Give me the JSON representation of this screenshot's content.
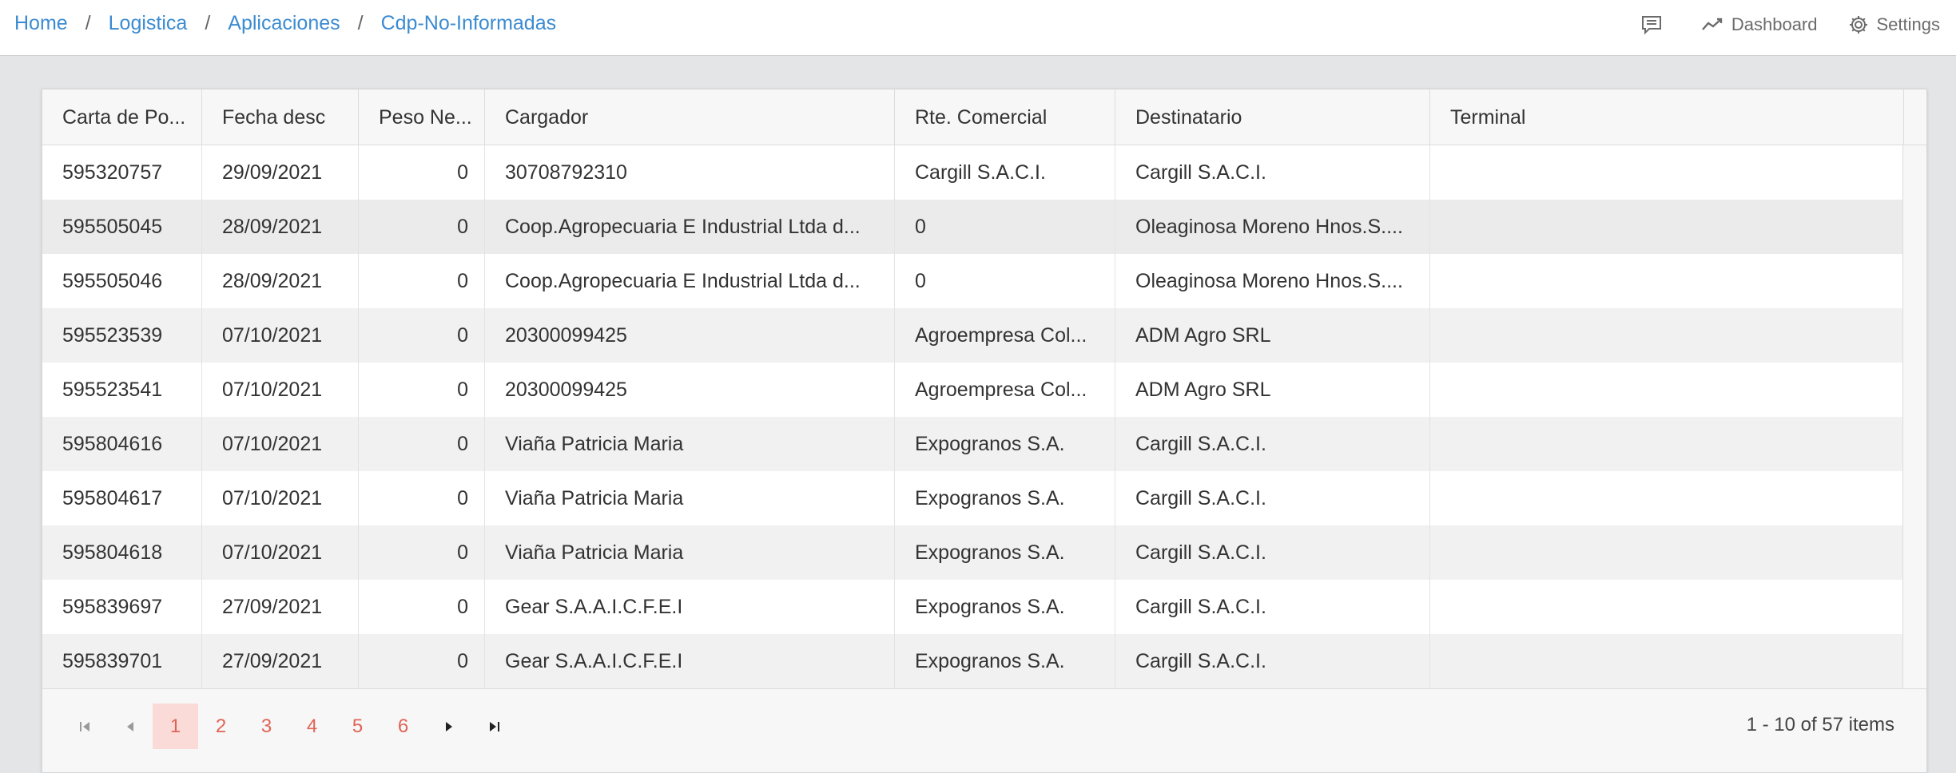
{
  "breadcrumb": [
    "Home",
    "Logistica",
    "Aplicaciones",
    "Cdp-No-Informadas"
  ],
  "topnav": {
    "chat_icon": "chat-icon",
    "dashboard_label": "Dashboard",
    "settings_label": "Settings"
  },
  "columns": [
    "Carta de Po...",
    "Fecha desc",
    "Peso Ne...",
    "Cargador",
    "Rte. Comercial",
    "Destinatario",
    "Terminal"
  ],
  "rows": [
    [
      "595320757",
      "29/09/2021",
      "0",
      "30708792310",
      "Cargill S.A.C.I.",
      "Cargill S.A.C.I.",
      ""
    ],
    [
      "595505045",
      "28/09/2021",
      "0",
      "Coop.Agropecuaria E Industrial Ltda d...",
      "0",
      "Oleaginosa Moreno Hnos.S....",
      ""
    ],
    [
      "595505046",
      "28/09/2021",
      "0",
      "Coop.Agropecuaria E Industrial Ltda d...",
      "0",
      "Oleaginosa Moreno Hnos.S....",
      ""
    ],
    [
      "595523539",
      "07/10/2021",
      "0",
      "20300099425",
      "Agroempresa Col...",
      "ADM Agro SRL",
      ""
    ],
    [
      "595523541",
      "07/10/2021",
      "0",
      "20300099425",
      "Agroempresa Col...",
      "ADM Agro SRL",
      ""
    ],
    [
      "595804616",
      "07/10/2021",
      "0",
      "Viaña Patricia Maria",
      "Expogranos S.A.",
      "Cargill S.A.C.I.",
      ""
    ],
    [
      "595804617",
      "07/10/2021",
      "0",
      "Viaña Patricia Maria",
      "Expogranos S.A.",
      "Cargill S.A.C.I.",
      ""
    ],
    [
      "595804618",
      "07/10/2021",
      "0",
      "Viaña Patricia Maria",
      "Expogranos S.A.",
      "Cargill S.A.C.I.",
      ""
    ],
    [
      "595839697",
      "27/09/2021",
      "0",
      "Gear S.A.A.I.C.F.E.I",
      "Expogranos S.A.",
      "Cargill S.A.C.I.",
      ""
    ],
    [
      "595839701",
      "27/09/2021",
      "0",
      "Gear S.A.A.I.C.F.E.I",
      "Expogranos S.A.",
      "Cargill S.A.C.I.",
      ""
    ]
  ],
  "pager": {
    "pages": [
      "1",
      "2",
      "3",
      "4",
      "5",
      "6"
    ],
    "current": "1",
    "info": "1 - 10 of 57 items"
  },
  "colors": {
    "link": "#3b8bd1",
    "pager_accent": "#e06456",
    "pager_active_bg": "#fadbd8"
  }
}
